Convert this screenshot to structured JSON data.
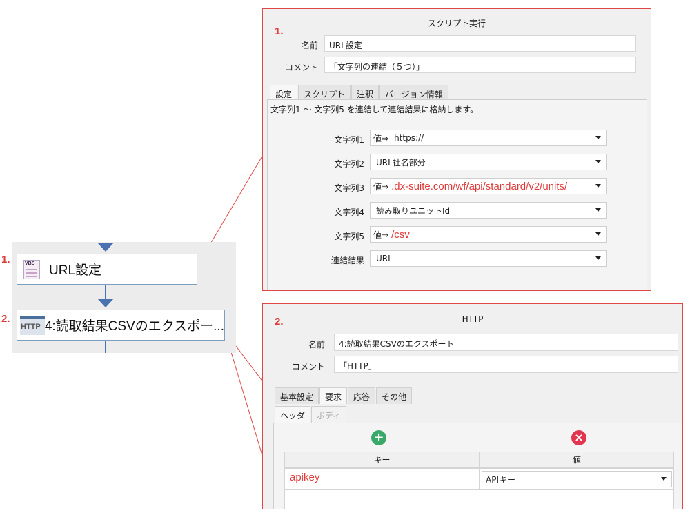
{
  "markers": {
    "one": "1.",
    "two": "2."
  },
  "flow": {
    "node1": {
      "label": "URL設定",
      "icon": "vbs-script-icon",
      "icon_text": "VBS"
    },
    "node2": {
      "label": "4:読取結果CSVのエクスポー...",
      "icon": "http-icon",
      "icon_text": "HTTP"
    }
  },
  "script_dialog": {
    "title": "スクリプト実行",
    "name_label": "名前",
    "name_value": "URL設定",
    "comment_label": "コメント",
    "comment_value": "「文字列の連結（５つ）」",
    "tabs": [
      "設定",
      "スクリプト",
      "注釈",
      "バージョン情報"
    ],
    "description": "文字列1 〜 文字列5 を連結して連結結果に格納します。",
    "rows": [
      {
        "label": "文字列1",
        "prefix": "値⇒",
        "value": "https://"
      },
      {
        "label": "文字列2",
        "prefix": "",
        "value": "URL社名部分"
      },
      {
        "label": "文字列3",
        "prefix": "値⇒",
        "value": ".dx-suite.com/wf/api/standard/v2/units/"
      },
      {
        "label": "文字列4",
        "prefix": "",
        "value": "読み取りユニットId"
      },
      {
        "label": "文字列5",
        "prefix": "値⇒",
        "value": "/csv"
      },
      {
        "label": "連結結果",
        "prefix": "",
        "value": "URL"
      }
    ]
  },
  "http_dialog": {
    "title": "HTTP",
    "name_label": "名前",
    "name_value": "4:読取結果CSVのエクスポート",
    "comment_label": "コメント",
    "comment_value": "「HTTP」",
    "tabs": [
      "基本設定",
      "要求",
      "応答",
      "その他"
    ],
    "subtabs": [
      "ヘッダ",
      "ボディ"
    ],
    "table_headers": [
      "キー",
      "値"
    ],
    "row": {
      "key": "apikey",
      "value": "APIキー"
    }
  },
  "colors": {
    "highlight_red": "#e03a3a",
    "flow_blue": "#4a72b0",
    "add_green": "#3aa869",
    "remove_red": "#e0364f"
  }
}
